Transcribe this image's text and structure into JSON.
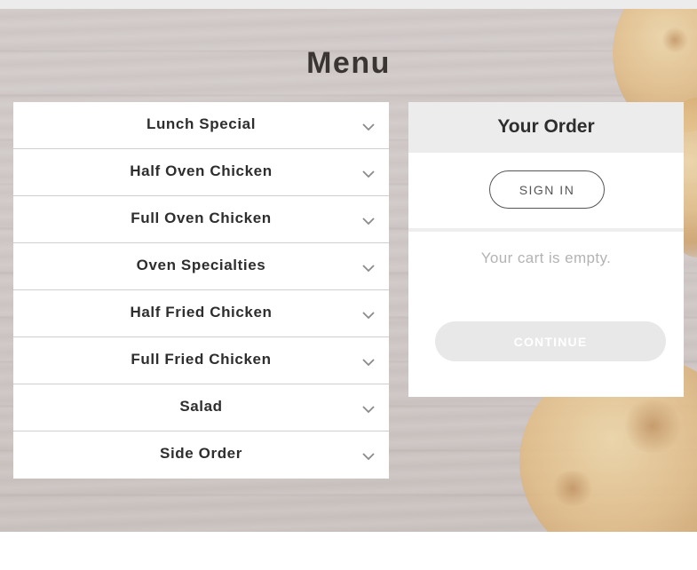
{
  "menu": {
    "title": "Menu",
    "categories": [
      {
        "label": "Lunch Special"
      },
      {
        "label": "Half Oven Chicken"
      },
      {
        "label": "Full Oven Chicken"
      },
      {
        "label": "Oven Specialties"
      },
      {
        "label": "Half Fried Chicken"
      },
      {
        "label": "Full Fried Chicken"
      },
      {
        "label": "Salad"
      },
      {
        "label": "Side Order"
      }
    ],
    "expand_icon": "chevron-down-icon"
  },
  "order": {
    "title": "Your Order",
    "signin_label": "SIGN IN",
    "cart_empty_text": "Your cart is empty.",
    "continue_label": "CONTINUE",
    "continue_enabled": false
  },
  "colors": {
    "heading": "#3a3533",
    "panel_header_bg": "#ececec",
    "continue_disabled_bg": "#e8e8e8",
    "muted_text": "#b3b3b3"
  }
}
